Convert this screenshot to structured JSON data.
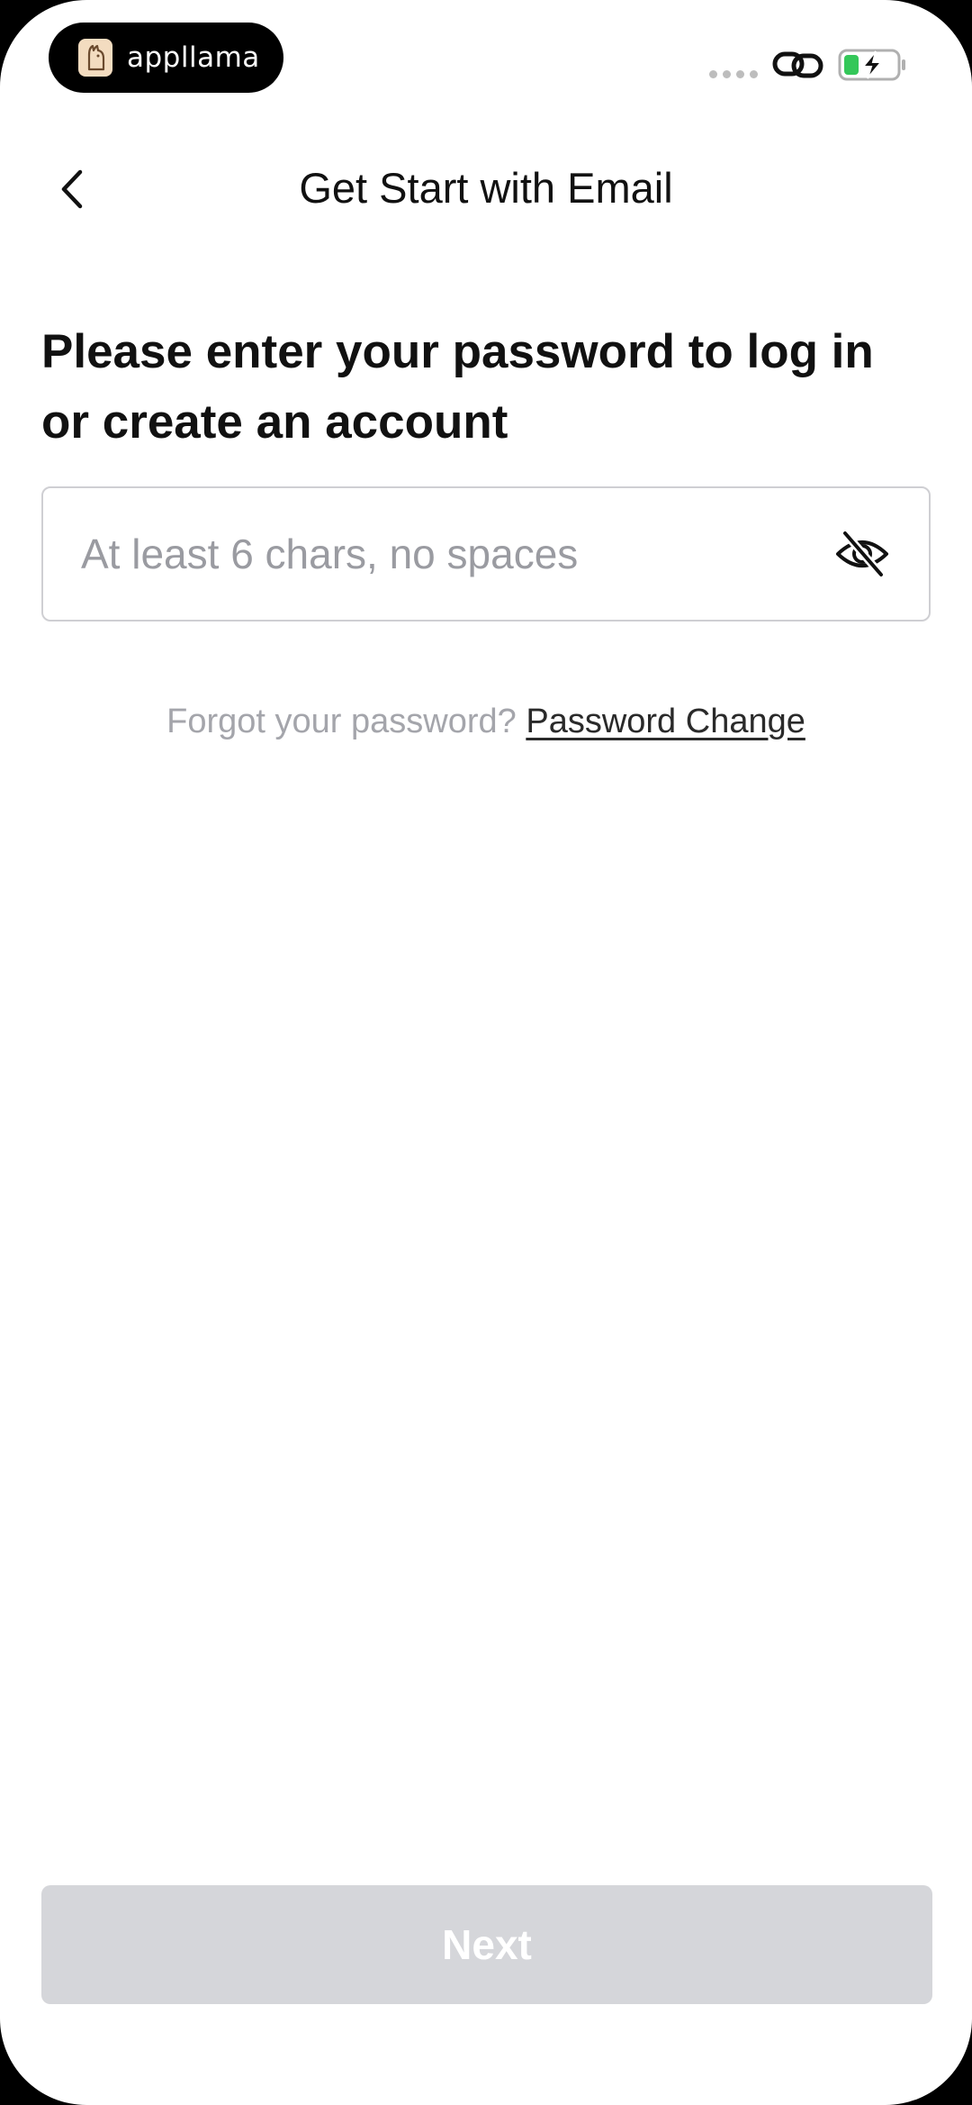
{
  "status_bar": {
    "brand_name": "appllama",
    "icons": [
      "llama-logo-icon",
      "signal-dots-icon",
      "link-icon",
      "battery-charging-icon"
    ]
  },
  "nav": {
    "title": "Get Start with Email",
    "back_icon": "chevron-left-icon"
  },
  "main": {
    "headline": "Please enter your password to log in or create an account",
    "password": {
      "value": "",
      "placeholder": "At least 6 chars, no spaces",
      "visibility_icon": "eye-off-icon"
    },
    "forgot_text": "Forgot your password?",
    "change_link": "Password Change"
  },
  "footer": {
    "next_label": "Next"
  },
  "colors": {
    "battery_green": "#34c759",
    "button_disabled": "#d5d6da",
    "placeholder": "#9a9ba1"
  }
}
